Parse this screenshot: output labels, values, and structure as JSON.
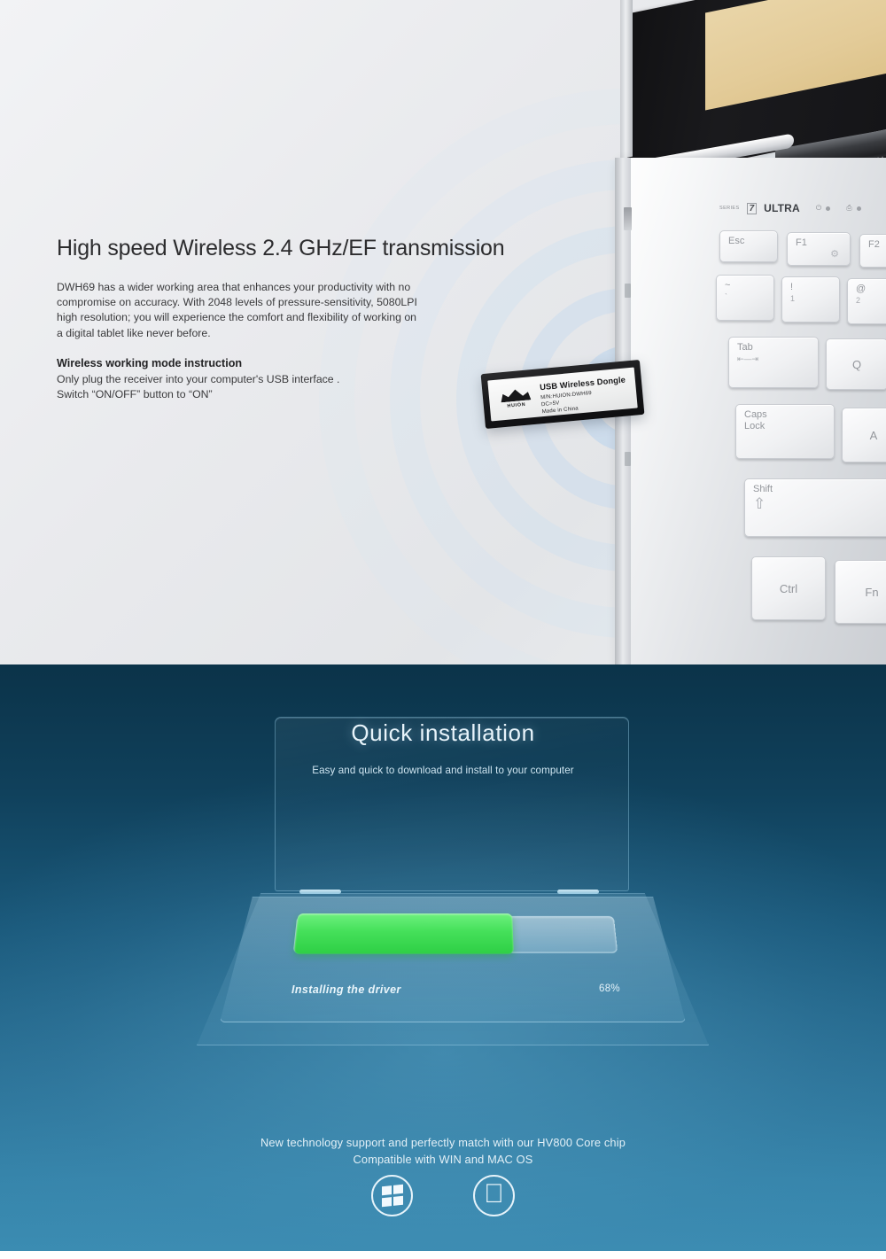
{
  "top": {
    "headline": "High speed Wireless 2.4 GHz/EF transmission",
    "body": "DWH69 has a wider working area that enhances your productivity with no compromise on accuracy. With 2048 levels of pressure-sensitivity, 5080LPI high resolution; you will experience the comfort and flexibility of working on a digital tablet like never before.",
    "sub_heading": "Wireless working mode instruction",
    "sub_body": "Only plug the receiver into your computer's USB interface .\nSwitch \"ON/OFF\" button to \"ON\"",
    "sub_body_line1": "Only plug the receiver into your computer's USB interface .",
    "sub_body_line2": "Switch “ON/OFF” button to “ON”"
  },
  "dongle": {
    "title": "USB Wireless Dongle",
    "model": "M/N:HUION:DWH69",
    "voltage": "DC=5V",
    "origin": "Made in China",
    "brand": "HUION",
    "brand_icon": "crown-icon"
  },
  "laptop": {
    "series_label": "SERIES",
    "series_number": "7",
    "series_tier": "ULTRA",
    "indicators": [
      {
        "icon": "power-icon",
        "glyph": "⏻"
      },
      {
        "icon": "hdd-icon",
        "glyph": "⎙"
      }
    ],
    "keys": [
      {
        "name": "esc",
        "main": "Esc",
        "sub": ""
      },
      {
        "name": "f1",
        "main": "F1",
        "sub": "",
        "glyph": "⚙"
      },
      {
        "name": "f2",
        "main": "F2",
        "sub": "",
        "glyph": "☀"
      },
      {
        "name": "tilde",
        "main": "~",
        "sub": "`"
      },
      {
        "name": "one",
        "main": "!",
        "sub": "1"
      },
      {
        "name": "two",
        "main": "@",
        "sub": "2"
      },
      {
        "name": "tab",
        "main": "Tab",
        "sub": "⇤—⇥"
      },
      {
        "name": "q",
        "main": "Q",
        "sub": ""
      },
      {
        "name": "capslock",
        "main": "Caps",
        "sub": "Lock"
      },
      {
        "name": "a",
        "main": "A",
        "sub": ""
      },
      {
        "name": "shift",
        "main": "Shift",
        "sub": "⇧"
      },
      {
        "name": "ctrl",
        "main": "Ctrl",
        "sub": ""
      },
      {
        "name": "fn",
        "main": "Fn",
        "sub": ""
      }
    ]
  },
  "bottom": {
    "quick_title": "Quick installation",
    "quick_subtitle": "Easy and quick to download and install to your computer",
    "status_text": "Installing the driver",
    "progress_percent_label": "68%",
    "progress_percent_value": 68,
    "footer_line1": "New technology support and perfectly match with our HV800 Core chip",
    "footer_line2": "Compatible with WIN and MAC OS",
    "os_badges": [
      {
        "name": "windows-icon",
        "label": "WIN"
      },
      {
        "name": "apple-icon",
        "label": "MAC OS",
        "glyph": ""
      }
    ]
  },
  "colors": {
    "progress_green": "#45e05a",
    "blue_dark": "#0b3349",
    "blue_light": "#3b8cb2",
    "accent_ring": "#bad4ec"
  }
}
